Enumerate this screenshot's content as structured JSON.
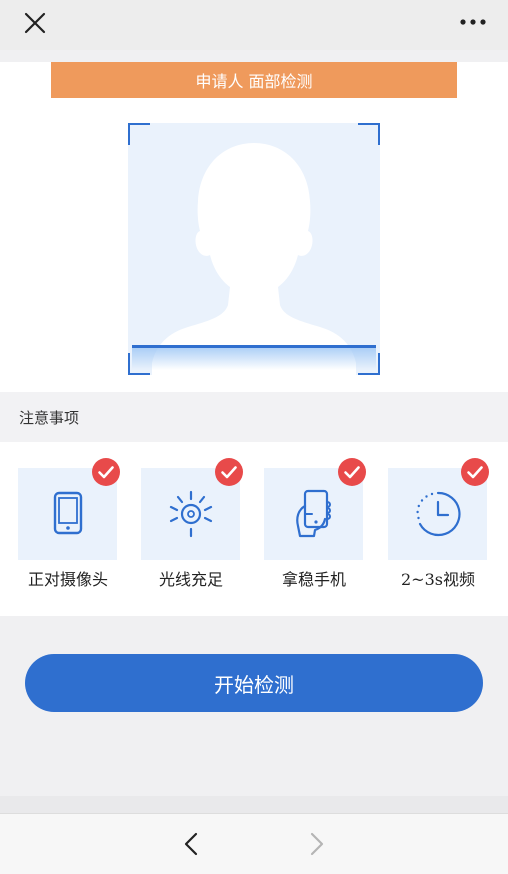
{
  "topbar": {
    "close_icon": "close-icon",
    "more_icon": "more-dots-icon"
  },
  "banner": {
    "text": "申请人 面部检测"
  },
  "face_capture": {
    "icon": "person-silhouette-icon",
    "accent_color": "#2f6fcf",
    "background_color": "#eaf2fc"
  },
  "notice": {
    "title": "注意事项"
  },
  "tips": [
    {
      "label": "正对摄像头",
      "icon": "tablet-icon",
      "checked": true
    },
    {
      "label": "光线充足",
      "icon": "sun-icon",
      "checked": true
    },
    {
      "label": "拿稳手机",
      "icon": "hand-phone-icon",
      "checked": true
    },
    {
      "label": "2~3s视频",
      "icon": "clock-icon",
      "checked": true
    }
  ],
  "actions": {
    "start_label": "开始检测"
  },
  "navigation": {
    "back_icon": "chevron-left-icon",
    "forward_icon": "chevron-right-icon"
  },
  "colors": {
    "banner": "#ef9a5c",
    "primary": "#2f6fcf",
    "check": "#e84a4a"
  }
}
